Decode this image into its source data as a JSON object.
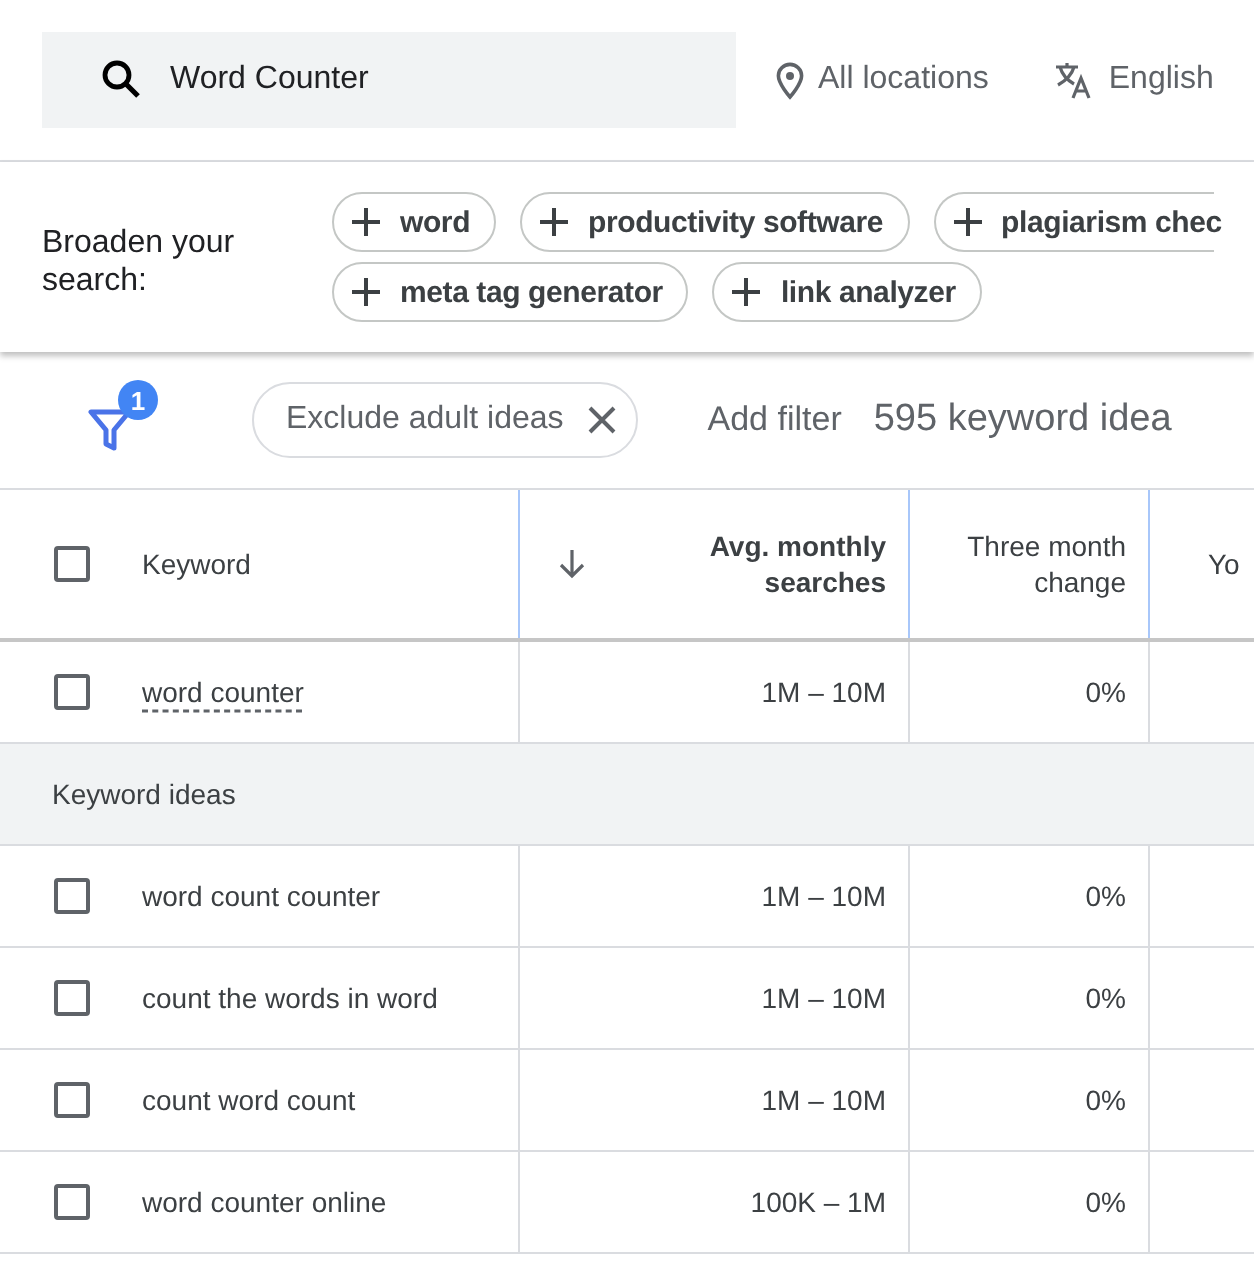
{
  "search": {
    "value": "Word Counter",
    "location": "All locations",
    "language": "English"
  },
  "broaden": {
    "label": "Broaden your search:",
    "chips": [
      {
        "label": "word"
      },
      {
        "label": "productivity software"
      },
      {
        "label": "plagiarism chec"
      },
      {
        "label": "meta tag generator"
      },
      {
        "label": "link analyzer"
      }
    ]
  },
  "filters": {
    "badge": "1",
    "chips": [
      {
        "label": "Exclude adult ideas"
      }
    ],
    "add_filter": "Add filter",
    "count": "595 keyword idea"
  },
  "table": {
    "select_all_checked": false,
    "columns": [
      {
        "label": "Keyword",
        "sorted": false
      },
      {
        "label": "Avg. monthly searches",
        "sorted": true
      },
      {
        "label": "Three month change",
        "sorted": false
      },
      {
        "label": "Yo",
        "sorted": false
      }
    ],
    "rows": [
      {
        "kind": "seed",
        "checked": false,
        "keyword": "word counter",
        "searches": "1M – 10M",
        "change": "0%"
      },
      {
        "kind": "group",
        "label": "Keyword ideas"
      },
      {
        "kind": "idea",
        "checked": false,
        "keyword": "word count counter",
        "searches": "1M – 10M",
        "change": "0%"
      },
      {
        "kind": "idea",
        "checked": false,
        "keyword": "count the words in word",
        "searches": "1M – 10M",
        "change": "0%"
      },
      {
        "kind": "idea",
        "checked": false,
        "keyword": "count word count",
        "searches": "1M – 10M",
        "change": "0%"
      },
      {
        "kind": "idea",
        "checked": false,
        "keyword": "word counter online",
        "searches": "100K – 1M",
        "change": "0%"
      }
    ]
  }
}
